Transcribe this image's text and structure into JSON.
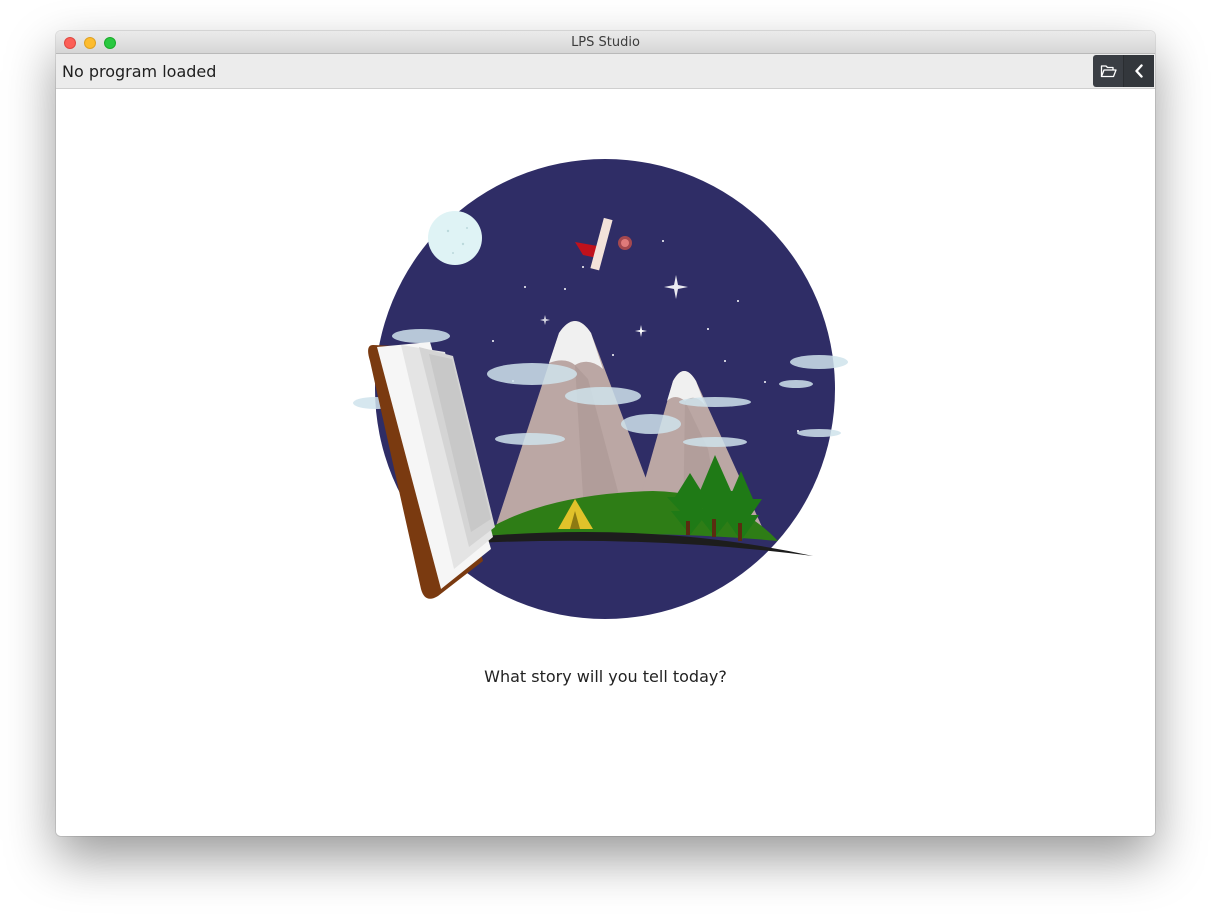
{
  "window": {
    "title": "LPS Studio"
  },
  "toolbar": {
    "status": "No program loaded",
    "open_icon": "folder-open-icon",
    "collapse_icon": "chevron-left-icon"
  },
  "main": {
    "tagline": "What story will you tell today?"
  },
  "colors": {
    "night_sky": "#2f2d66",
    "moon": "#dff3f5",
    "mountain": "#bba7a4",
    "snow": "#f0f0f0",
    "grass": "#2e7d16",
    "trees": "#1f7a16",
    "tent": "#e0c22a",
    "book_cover": "#7a3a10",
    "toolbar_button_bg": "#3a3e44"
  }
}
